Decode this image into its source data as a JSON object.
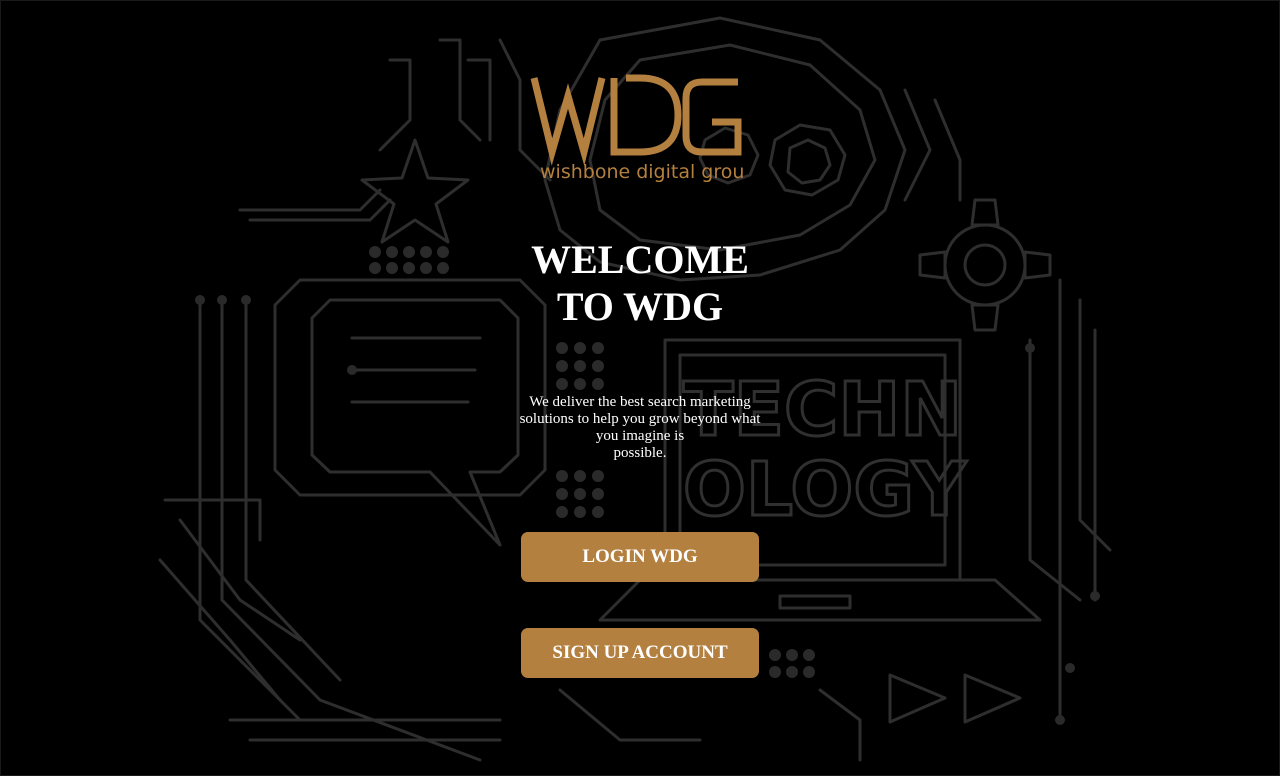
{
  "colors": {
    "background": "#000000",
    "accent": "#b4803f",
    "text": "#ffffff",
    "circuit_lines": "#2e2e2e"
  },
  "logo": {
    "mark": "WDG",
    "tagline": "wishbone digital group"
  },
  "hero": {
    "title_line1": "WELCOME",
    "title_line2": "TO WDG",
    "tagline_lines": [
      "We deliver the best search marketing",
      "solutions to help you grow beyond what",
      "you imagine is",
      "possible."
    ]
  },
  "buttons": {
    "login_label": "LOGIN WDG",
    "signup_label": "SIGN UP ACCOUNT"
  },
  "background": {
    "art_text_line1": "TECHN",
    "art_text_line2": "OLOGY"
  }
}
